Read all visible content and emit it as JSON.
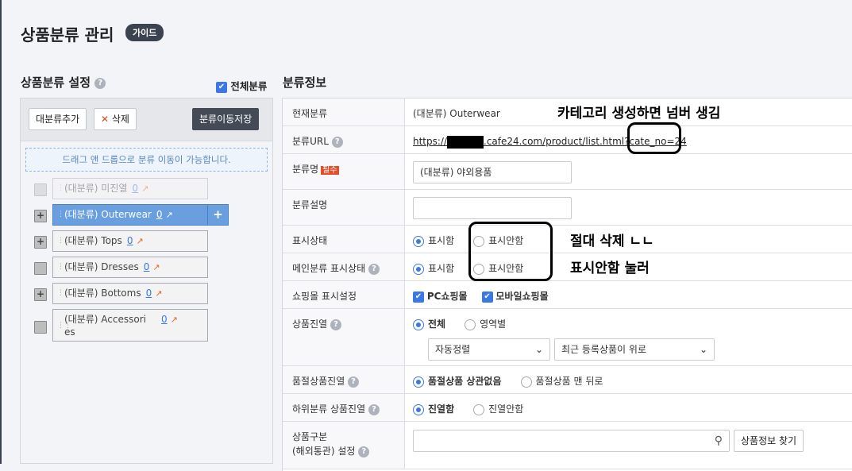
{
  "page": {
    "title": "상품분류 관리",
    "guide": "가이드"
  },
  "left": {
    "title": "상품분류 설정",
    "all_label": "전체분류",
    "add": "대분류추가",
    "delete": "삭제",
    "save_move": "분류이동저장",
    "dnd_hint": "드래그 앤 드롭으로 분류 이동이 가능합니다.",
    "nodes": [
      {
        "label": "(대분류) 미진열",
        "count": "0"
      },
      {
        "label": "(대분류) Outerwear",
        "count": "0"
      },
      {
        "label": "(대분류) Tops",
        "count": "0"
      },
      {
        "label": "(대분류) Dresses",
        "count": "0"
      },
      {
        "label": "(대분류) Bottoms",
        "count": "0"
      },
      {
        "label": "(대분류) Accessori es",
        "count": "0"
      }
    ]
  },
  "info": {
    "title": "분류정보",
    "current_label": "현재분류",
    "current_value": "(대분류) Outerwear",
    "url_label": "분류URL",
    "url_prefix": "https://",
    "url_suffix": ".cafe24.com/product/list.html?cate_no=24",
    "name_label": "분류명",
    "required": "필수",
    "name_value": "(대분류) 야외용품",
    "desc_label": "분류설명",
    "display_label": "표시상태",
    "show": "표시함",
    "hide": "표시안함",
    "main_display_label": "메인분류 표시상태",
    "mall_label": "쇼핑몰 표시설정",
    "pc": "PC쇼핑몰",
    "mobile": "모바일쇼핑몰",
    "product_display_label": "상품진열",
    "all": "전체",
    "by_area": "영역별",
    "sort1": "자동정렬",
    "sort2": "최근 등록상품이 위로",
    "soldout_label": "품절상품진열",
    "soldout_opt1": "품절상품 상관없음",
    "soldout_opt2": "품절상품 맨 뒤로",
    "sub_label": "하위분류 상품진열",
    "sub_opt1": "진열함",
    "sub_opt2": "진열안함",
    "type_label_1": "상품구분",
    "type_label_2": "(해외통관) 설정",
    "find_btn": "상품정보 찾기"
  },
  "annotations": {
    "note1": "카테고리 생성하면 넘버 생김",
    "note2": "절대 삭제 ㄴㄴ",
    "note3": "표시안함 눌러"
  }
}
